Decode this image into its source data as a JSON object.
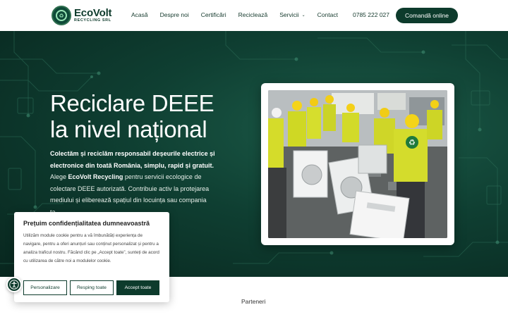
{
  "brand": {
    "name": "EcoVolt",
    "subtitle": "RECYCLING SRL",
    "primary_color": "#0d3b2c"
  },
  "nav": {
    "items": [
      {
        "label": "Acasă"
      },
      {
        "label": "Despre noi"
      },
      {
        "label": "Certificări"
      },
      {
        "label": "Reciclează"
      },
      {
        "label": "Servicii",
        "has_dropdown": true
      },
      {
        "label": "Contact"
      }
    ],
    "phone": "0785 222 027",
    "cta_label": "Comandă online"
  },
  "hero": {
    "title_line1": "Reciclare DEEE",
    "title_line2": "la nivel național",
    "text_bold": "Colectăm și reciclăm responsabil deșeurile electrice și electronice din toată România, simplu, rapid și gratuit.",
    "text_pre_brand": " Alege ",
    "text_brand": "EcoVolt Recycling",
    "text_post_brand": " pentru servicii ecologice de colectare DEEE autorizată. Contribuie activ la protejarea mediului și eliberează spațiul din locuința sau compania ta."
  },
  "photo": {
    "icon": "recycle-icon"
  },
  "partners": {
    "heading": "Parteneri"
  },
  "cookie": {
    "title": "Prețuim confidențialitatea dumneavoastră",
    "text": "Utilizăm module cookie pentru a vă îmbunătăți experiența de navigare, pentru a oferi anunțuri sau conținut personalizat și pentru a analiza traficul nostru. Făcând clic pe „Accept toate”, sunteți de acord cu utilizarea de către noi a modulelor cookie.",
    "btn_customize": "Personalizare",
    "btn_reject": "Resping toate",
    "btn_accept": "Accept toate"
  },
  "accessibility": {
    "icon": "accessibility-icon"
  }
}
